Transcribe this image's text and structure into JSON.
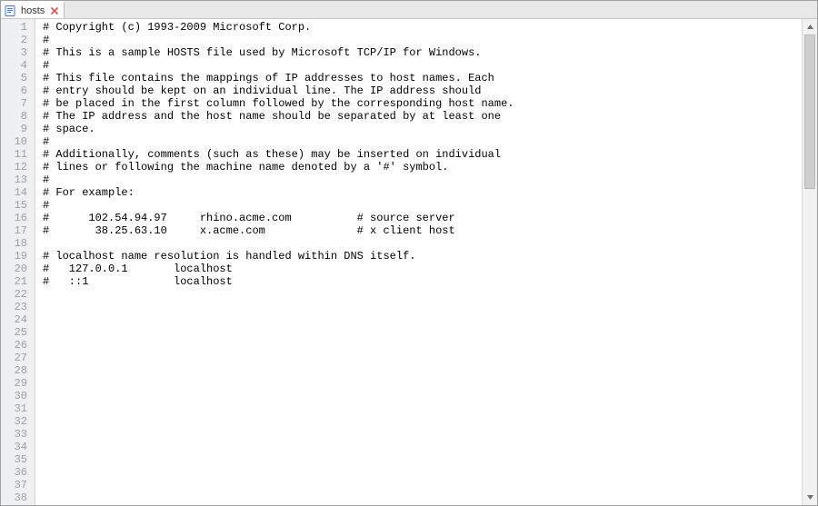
{
  "tab": {
    "filename": "hosts",
    "file_icon": "file-icon",
    "close_icon": "close-icon"
  },
  "editor": {
    "visible_line_count": 38,
    "lines": [
      "# Copyright (c) 1993-2009 Microsoft Corp.",
      "#",
      "# This is a sample HOSTS file used by Microsoft TCP/IP for Windows.",
      "#",
      "# This file contains the mappings of IP addresses to host names. Each",
      "# entry should be kept on an individual line. The IP address should",
      "# be placed in the first column followed by the corresponding host name.",
      "# The IP address and the host name should be separated by at least one",
      "# space.",
      "#",
      "# Additionally, comments (such as these) may be inserted on individual",
      "# lines or following the machine name denoted by a '#' symbol.",
      "#",
      "# For example:",
      "#",
      "#      102.54.94.97     rhino.acme.com          # source server",
      "#       38.25.63.10     x.acme.com              # x client host",
      "",
      "# localhost name resolution is handled within DNS itself.",
      "#   127.0.0.1       localhost",
      "#   ::1             localhost",
      "",
      "",
      "",
      "",
      "",
      "",
      "",
      "",
      "",
      "",
      "",
      "",
      "",
      "",
      "",
      "",
      ""
    ]
  },
  "scrollbar": {
    "up_icon": "chevron-up-icon",
    "down_icon": "chevron-down-icon"
  }
}
